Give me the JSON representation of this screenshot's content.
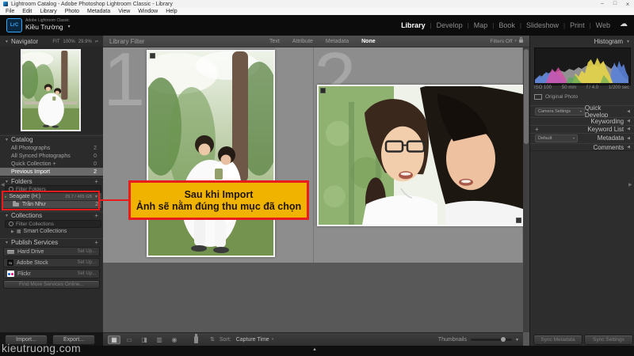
{
  "window": {
    "title": "Lightroom Catalog - Adobe Photoshop Lightroom Classic - Library",
    "minimize": "–",
    "maximize": "□",
    "close": "×"
  },
  "menubar": {
    "items": [
      "File",
      "Edit",
      "Library",
      "Photo",
      "Metadata",
      "View",
      "Window",
      "Help"
    ]
  },
  "identity": {
    "logo": "LrC",
    "app_line": "Adobe Lightroom Classic",
    "catalog_name": "Kiều Trường"
  },
  "modules": {
    "items": [
      "Library",
      "Develop",
      "Map",
      "Book",
      "Slideshow",
      "Print",
      "Web"
    ],
    "active": "Library"
  },
  "filter_bar": {
    "title": "Library Filter",
    "tabs": [
      "Text",
      "Attribute",
      "Metadata",
      "None"
    ],
    "active_tab": "None",
    "status": "Filters Off"
  },
  "grid": {
    "cells": [
      {
        "index": "1"
      },
      {
        "index": "2"
      }
    ]
  },
  "annotation": {
    "line1": "Sau khi Import",
    "line2": "Ảnh sẽ nằm đúng thu mục đã chọn"
  },
  "navigator": {
    "title": "Navigator",
    "zoom_levels": [
      "FIT",
      "100%",
      "29.9%"
    ]
  },
  "catalog": {
    "title": "Catalog",
    "items": [
      {
        "label": "All Photographs",
        "count": "2"
      },
      {
        "label": "All Synced Photographs",
        "count": "0"
      },
      {
        "label": "Quick Collection +",
        "count": "0"
      },
      {
        "label": "Previous Import",
        "count": "2"
      }
    ]
  },
  "folders": {
    "title": "Folders",
    "add": "+",
    "filter_placeholder": "Filter Folders",
    "volume": {
      "name": "Seagate (H:)",
      "capacity": "29.7 / 465 GB"
    },
    "items": [
      {
        "name": "Trần Như",
        "count": "2"
      }
    ]
  },
  "collections": {
    "title": "Collections",
    "add": "+",
    "filter_placeholder": "Filter Collections",
    "items": [
      {
        "name": "Smart Collections"
      }
    ]
  },
  "publish": {
    "title": "Publish Services",
    "add": "+",
    "services": [
      {
        "name": "Hard Drive",
        "action": "Set Up..."
      },
      {
        "name": "Adobe Stock",
        "action": "Set Up..."
      },
      {
        "name": "Flickr",
        "action": "Set Up..."
      }
    ],
    "more": "Find More Services Online..."
  },
  "histogram": {
    "title": "Histogram",
    "stats": [
      "ISO 100",
      "50 mm",
      "f / 4.0",
      "1/200 sec"
    ],
    "original": "Original Photo"
  },
  "right_sections": {
    "quick_develop": {
      "label": "Quick Develop",
      "dropdown": "Camera Settings"
    },
    "keywording": {
      "label": "Keywording"
    },
    "keyword_list": {
      "label": "Keyword List",
      "add": "+"
    },
    "metadata": {
      "label": "Metadata",
      "dropdown": "Default"
    },
    "comments": {
      "label": "Comments"
    }
  },
  "toolbar": {
    "sort_label": "Sort:",
    "sort_value": "Capture Time",
    "thumbnails_label": "Thumbnails"
  },
  "actions": {
    "import": "Import...",
    "export": "Export...",
    "sync_metadata": "Sync Metadata",
    "sync_settings": "Sync Settings"
  },
  "footer": {
    "watermark": "kieutruong.com"
  },
  "colors": {
    "annotation_yellow": "#f0b400",
    "annotation_red": "#e81c1c",
    "module_active": "#ffffff",
    "logo_blue": "#31a8ff"
  }
}
